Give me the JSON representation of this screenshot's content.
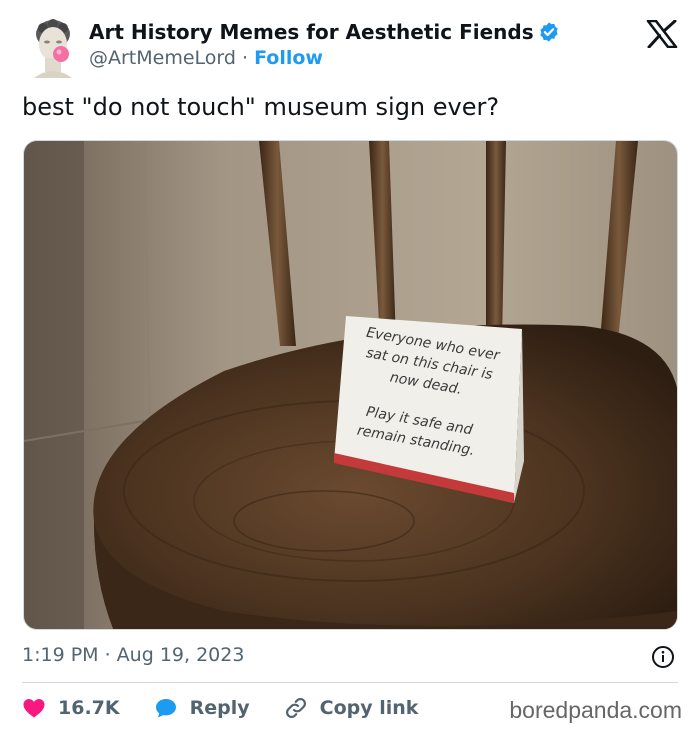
{
  "author": {
    "display_name": "Art History Memes for Aesthetic Fiends",
    "handle": "@ArtMemeLord",
    "separator": "·",
    "follow_label": "Follow",
    "avatar_icon": "statue-bubblegum-avatar",
    "verified_icon": "verified-badge-icon",
    "verified_color": "#1d9bf0"
  },
  "platform_icon": "x-logo-icon",
  "tweet": {
    "text": "best \"do not touch\" museum sign ever?",
    "timestamp": "1:19 PM · Aug 19, 2023"
  },
  "media": {
    "description_icon": "photo-chair-with-sign",
    "sign_lines_top": [
      "Everyone who ever",
      "sat on this chair is",
      "now dead."
    ],
    "sign_lines_bottom": [
      "Play it safe and",
      "remain standing."
    ]
  },
  "actions": {
    "like_count": "16.7K",
    "reply_label": "Reply",
    "copy_link_label": "Copy link",
    "like_color": "#f91880",
    "reply_color": "#1d9bf0"
  },
  "watermark": "boredpanda.com"
}
